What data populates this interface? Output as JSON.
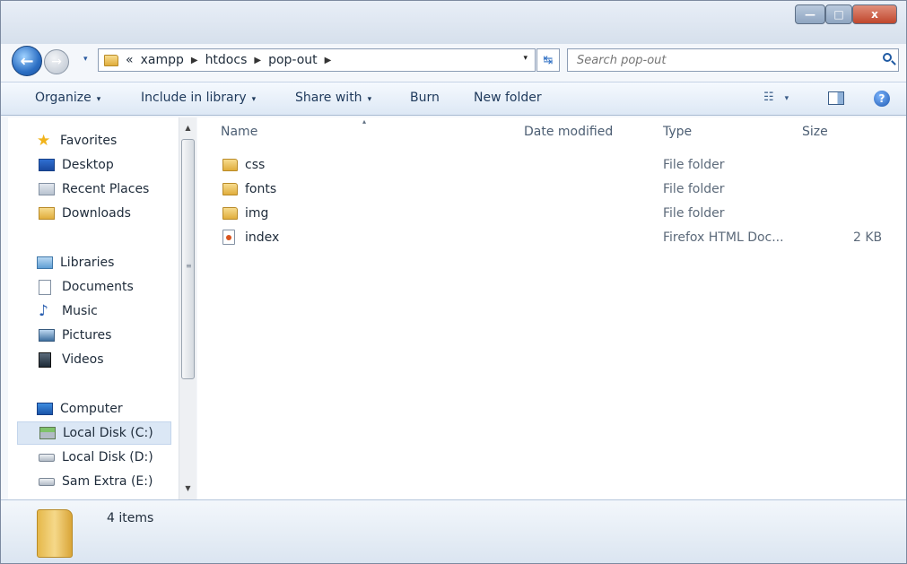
{
  "window": {
    "controls": {
      "minimize": "—",
      "maximize": "□",
      "close": "x"
    }
  },
  "nav": {
    "back": "←",
    "forward": "→",
    "history_dropdown": "▾"
  },
  "address": {
    "overflow": "«",
    "separator": "▶",
    "crumbs": [
      "xampp",
      "htdocs",
      "pop-out"
    ],
    "dropdown": "▾",
    "refresh": "↹"
  },
  "search": {
    "placeholder": "Search pop-out"
  },
  "toolbar": {
    "organize": "Organize",
    "include_in_library": "Include in library",
    "share_with": "Share with",
    "burn": "Burn",
    "new_folder": "New folder",
    "dropdown": "▾",
    "view_icon": "☷",
    "help": "?"
  },
  "sidebar": {
    "favorites": "Favorites",
    "desktop": "Desktop",
    "recent_places": "Recent Places",
    "downloads": "Downloads",
    "libraries": "Libraries",
    "documents": "Documents",
    "music": "Music",
    "pictures": "Pictures",
    "videos": "Videos",
    "computer": "Computer",
    "disk_c": "Local Disk (C:)",
    "disk_d": "Local Disk (D:)",
    "disk_e": "Sam Extra (E:)",
    "star_glyph": "★",
    "music_glyph": "♪",
    "scroll_up": "▲",
    "scroll_down": "▼",
    "thumb_grip": "≡"
  },
  "columns": {
    "name": "Name",
    "date_modified": "Date modified",
    "type": "Type",
    "size": "Size",
    "sort_indicator": "▴"
  },
  "files": [
    {
      "name": "css",
      "type": "File folder",
      "size": ""
    },
    {
      "name": "fonts",
      "type": "File folder",
      "size": ""
    },
    {
      "name": "img",
      "type": "File folder",
      "size": ""
    },
    {
      "name": "index",
      "type": "Firefox HTML Doc...",
      "size": "2 KB"
    }
  ],
  "status": {
    "item_count": "4 items"
  }
}
